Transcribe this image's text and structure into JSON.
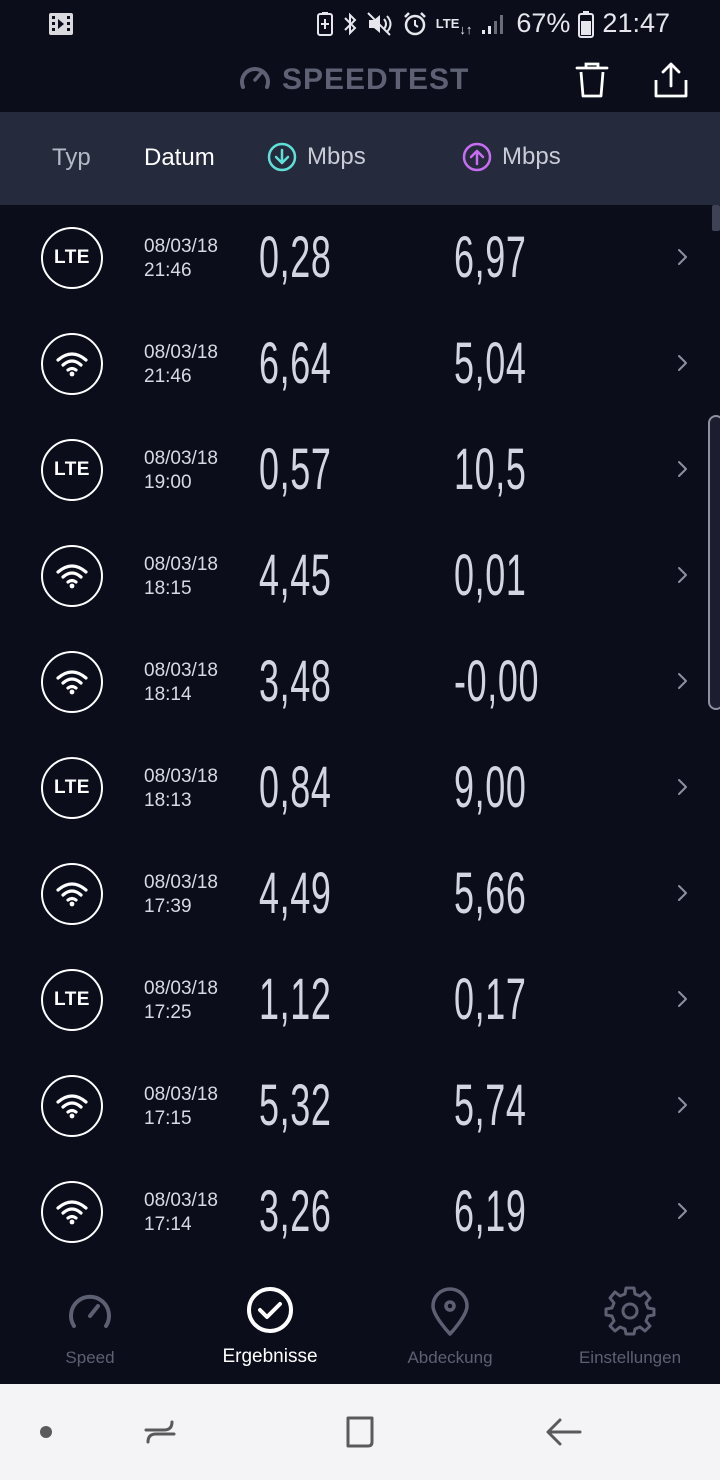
{
  "status_bar": {
    "battery_percent": "67%",
    "time": "21:47",
    "network": "LTE",
    "icons": [
      "video-icon",
      "battery-saver-icon",
      "bluetooth-icon",
      "mute-icon",
      "alarm-icon",
      "lte-icon",
      "signal-icon",
      "battery-icon"
    ]
  },
  "app_bar": {
    "title": "SPEEDTEST",
    "actions": [
      "trash-icon",
      "share-icon"
    ]
  },
  "columns": {
    "type": "Typ",
    "date": "Datum",
    "download": "Mbps",
    "upload": "Mbps"
  },
  "results": [
    {
      "type": "LTE",
      "date": "08/03/18",
      "time": "21:46",
      "download": "0,28",
      "upload": "6,97"
    },
    {
      "type": "WIFI",
      "date": "08/03/18",
      "time": "21:46",
      "download": "6,64",
      "upload": "5,04"
    },
    {
      "type": "LTE",
      "date": "08/03/18",
      "time": "19:00",
      "download": "0,57",
      "upload": "10,5"
    },
    {
      "type": "WIFI",
      "date": "08/03/18",
      "time": "18:15",
      "download": "4,45",
      "upload": "0,01"
    },
    {
      "type": "WIFI",
      "date": "08/03/18",
      "time": "18:14",
      "download": "3,48",
      "upload": "-0,00"
    },
    {
      "type": "LTE",
      "date": "08/03/18",
      "time": "18:13",
      "download": "0,84",
      "upload": "9,00"
    },
    {
      "type": "WIFI",
      "date": "08/03/18",
      "time": "17:39",
      "download": "4,49",
      "upload": "5,66"
    },
    {
      "type": "LTE",
      "date": "08/03/18",
      "time": "17:25",
      "download": "1,12",
      "upload": "0,17"
    },
    {
      "type": "WIFI",
      "date": "08/03/18",
      "time": "17:15",
      "download": "5,32",
      "upload": "5,74"
    },
    {
      "type": "WIFI",
      "date": "08/03/18",
      "time": "17:14",
      "download": "3,26",
      "upload": "6,19"
    }
  ],
  "bottom_nav": {
    "speed": "Speed",
    "results": "Ergebnisse",
    "coverage": "Abdeckung",
    "settings": "Einstellungen",
    "active": "results"
  },
  "colors": {
    "background": "#0b0d1b",
    "header": "#262a3d",
    "download_accent": "#5fdfd6",
    "upload_accent": "#c76df2"
  }
}
